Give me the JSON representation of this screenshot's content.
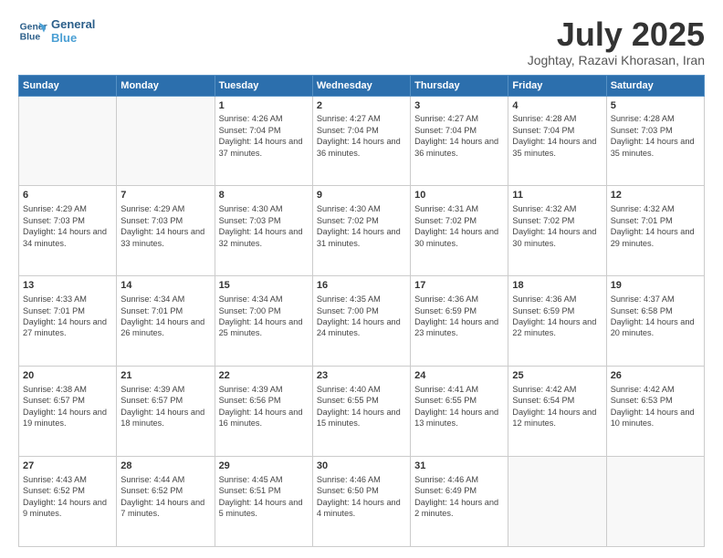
{
  "header": {
    "logo_line1": "General",
    "logo_line2": "Blue",
    "month": "July 2025",
    "location": "Joghtay, Razavi Khorasan, Iran"
  },
  "weekdays": [
    "Sunday",
    "Monday",
    "Tuesday",
    "Wednesday",
    "Thursday",
    "Friday",
    "Saturday"
  ],
  "weeks": [
    [
      {
        "day": "",
        "info": ""
      },
      {
        "day": "",
        "info": ""
      },
      {
        "day": "1",
        "info": "Sunrise: 4:26 AM\nSunset: 7:04 PM\nDaylight: 14 hours and 37 minutes."
      },
      {
        "day": "2",
        "info": "Sunrise: 4:27 AM\nSunset: 7:04 PM\nDaylight: 14 hours and 36 minutes."
      },
      {
        "day": "3",
        "info": "Sunrise: 4:27 AM\nSunset: 7:04 PM\nDaylight: 14 hours and 36 minutes."
      },
      {
        "day": "4",
        "info": "Sunrise: 4:28 AM\nSunset: 7:04 PM\nDaylight: 14 hours and 35 minutes."
      },
      {
        "day": "5",
        "info": "Sunrise: 4:28 AM\nSunset: 7:03 PM\nDaylight: 14 hours and 35 minutes."
      }
    ],
    [
      {
        "day": "6",
        "info": "Sunrise: 4:29 AM\nSunset: 7:03 PM\nDaylight: 14 hours and 34 minutes."
      },
      {
        "day": "7",
        "info": "Sunrise: 4:29 AM\nSunset: 7:03 PM\nDaylight: 14 hours and 33 minutes."
      },
      {
        "day": "8",
        "info": "Sunrise: 4:30 AM\nSunset: 7:03 PM\nDaylight: 14 hours and 32 minutes."
      },
      {
        "day": "9",
        "info": "Sunrise: 4:30 AM\nSunset: 7:02 PM\nDaylight: 14 hours and 31 minutes."
      },
      {
        "day": "10",
        "info": "Sunrise: 4:31 AM\nSunset: 7:02 PM\nDaylight: 14 hours and 30 minutes."
      },
      {
        "day": "11",
        "info": "Sunrise: 4:32 AM\nSunset: 7:02 PM\nDaylight: 14 hours and 30 minutes."
      },
      {
        "day": "12",
        "info": "Sunrise: 4:32 AM\nSunset: 7:01 PM\nDaylight: 14 hours and 29 minutes."
      }
    ],
    [
      {
        "day": "13",
        "info": "Sunrise: 4:33 AM\nSunset: 7:01 PM\nDaylight: 14 hours and 27 minutes."
      },
      {
        "day": "14",
        "info": "Sunrise: 4:34 AM\nSunset: 7:01 PM\nDaylight: 14 hours and 26 minutes."
      },
      {
        "day": "15",
        "info": "Sunrise: 4:34 AM\nSunset: 7:00 PM\nDaylight: 14 hours and 25 minutes."
      },
      {
        "day": "16",
        "info": "Sunrise: 4:35 AM\nSunset: 7:00 PM\nDaylight: 14 hours and 24 minutes."
      },
      {
        "day": "17",
        "info": "Sunrise: 4:36 AM\nSunset: 6:59 PM\nDaylight: 14 hours and 23 minutes."
      },
      {
        "day": "18",
        "info": "Sunrise: 4:36 AM\nSunset: 6:59 PM\nDaylight: 14 hours and 22 minutes."
      },
      {
        "day": "19",
        "info": "Sunrise: 4:37 AM\nSunset: 6:58 PM\nDaylight: 14 hours and 20 minutes."
      }
    ],
    [
      {
        "day": "20",
        "info": "Sunrise: 4:38 AM\nSunset: 6:57 PM\nDaylight: 14 hours and 19 minutes."
      },
      {
        "day": "21",
        "info": "Sunrise: 4:39 AM\nSunset: 6:57 PM\nDaylight: 14 hours and 18 minutes."
      },
      {
        "day": "22",
        "info": "Sunrise: 4:39 AM\nSunset: 6:56 PM\nDaylight: 14 hours and 16 minutes."
      },
      {
        "day": "23",
        "info": "Sunrise: 4:40 AM\nSunset: 6:55 PM\nDaylight: 14 hours and 15 minutes."
      },
      {
        "day": "24",
        "info": "Sunrise: 4:41 AM\nSunset: 6:55 PM\nDaylight: 14 hours and 13 minutes."
      },
      {
        "day": "25",
        "info": "Sunrise: 4:42 AM\nSunset: 6:54 PM\nDaylight: 14 hours and 12 minutes."
      },
      {
        "day": "26",
        "info": "Sunrise: 4:42 AM\nSunset: 6:53 PM\nDaylight: 14 hours and 10 minutes."
      }
    ],
    [
      {
        "day": "27",
        "info": "Sunrise: 4:43 AM\nSunset: 6:52 PM\nDaylight: 14 hours and 9 minutes."
      },
      {
        "day": "28",
        "info": "Sunrise: 4:44 AM\nSunset: 6:52 PM\nDaylight: 14 hours and 7 minutes."
      },
      {
        "day": "29",
        "info": "Sunrise: 4:45 AM\nSunset: 6:51 PM\nDaylight: 14 hours and 5 minutes."
      },
      {
        "day": "30",
        "info": "Sunrise: 4:46 AM\nSunset: 6:50 PM\nDaylight: 14 hours and 4 minutes."
      },
      {
        "day": "31",
        "info": "Sunrise: 4:46 AM\nSunset: 6:49 PM\nDaylight: 14 hours and 2 minutes."
      },
      {
        "day": "",
        "info": ""
      },
      {
        "day": "",
        "info": ""
      }
    ]
  ]
}
